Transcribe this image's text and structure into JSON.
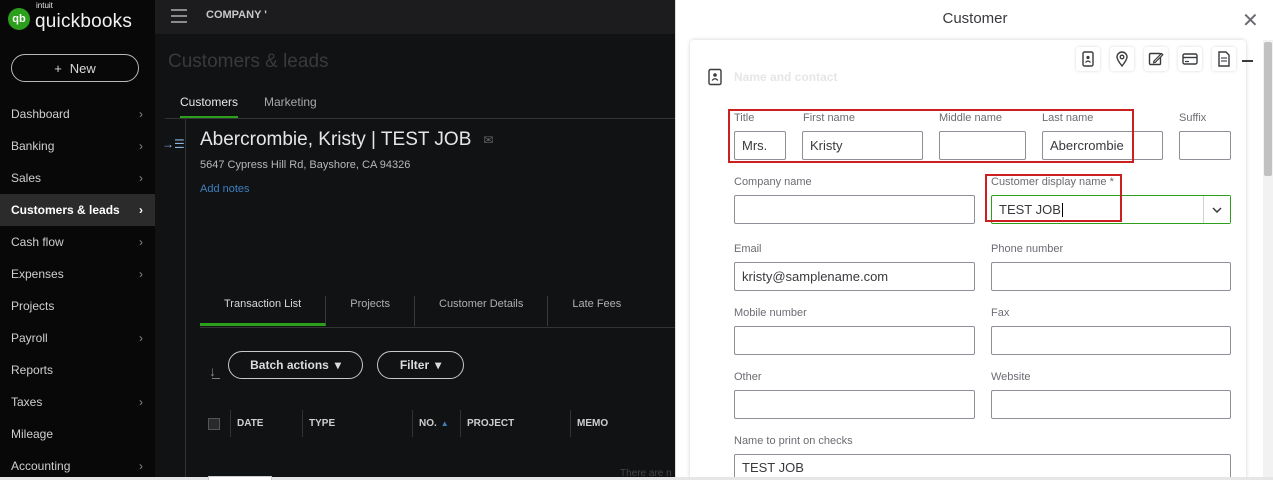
{
  "app": {
    "brand_small": "intuit",
    "brand_name": "quickbooks",
    "brand_badge": "qb",
    "company": "COMPANY '"
  },
  "leftnav": {
    "new_button": "New",
    "new_icon": "plus-icon",
    "items": [
      {
        "label": "Dashboard",
        "chevron": true,
        "active": false
      },
      {
        "label": "Banking",
        "chevron": true,
        "active": false
      },
      {
        "label": "Sales",
        "chevron": true,
        "active": false
      },
      {
        "label": "Customers & leads",
        "chevron": true,
        "active": true
      },
      {
        "label": "Cash flow",
        "chevron": true,
        "active": false
      },
      {
        "label": "Expenses",
        "chevron": true,
        "active": false
      },
      {
        "label": "Projects",
        "chevron": false,
        "active": false
      },
      {
        "label": "Payroll",
        "chevron": true,
        "active": false
      },
      {
        "label": "Reports",
        "chevron": false,
        "active": false
      },
      {
        "label": "Taxes",
        "chevron": true,
        "active": false
      },
      {
        "label": "Mileage",
        "chevron": false,
        "active": false
      },
      {
        "label": "Accounting",
        "chevron": true,
        "active": false
      }
    ]
  },
  "page": {
    "title": "Customers & leads",
    "tabs": [
      "Customers",
      "Marketing"
    ],
    "active_tab": "Customers",
    "customer_name": "Abercrombie, Kristy | TEST JOB",
    "address": "5647 Cypress Hill Rd, Bayshore, CA 94326",
    "add_notes": "Add notes",
    "detail_tabs": [
      "Transaction List",
      "Projects",
      "Customer Details",
      "Late Fees"
    ],
    "batch_actions": "Batch actions",
    "filter": "Filter",
    "table_headers": [
      "DATE",
      "TYPE",
      "NO.",
      "PROJECT",
      "MEMO"
    ],
    "sorted_column": "NO.",
    "footer_text": "There are n"
  },
  "panel": {
    "title": "Customer",
    "section_title": "Name and contact",
    "toolbar_icons": [
      "contact-book-icon",
      "location-pin-icon",
      "edit-note-icon",
      "payment-card-icon",
      "document-icon"
    ],
    "fields": {
      "title": {
        "label": "Title",
        "value": "Mrs."
      },
      "first_name": {
        "label": "First name",
        "value": "Kristy"
      },
      "middle_name": {
        "label": "Middle name",
        "value": ""
      },
      "last_name": {
        "label": "Last name",
        "value": "Abercrombie"
      },
      "suffix": {
        "label": "Suffix",
        "value": ""
      },
      "company_name": {
        "label": "Company name",
        "value": ""
      },
      "display_name": {
        "label": "Customer display name *",
        "value": "TEST JOB"
      },
      "email": {
        "label": "Email",
        "value": "kristy@samplename.com"
      },
      "phone": {
        "label": "Phone number",
        "value": ""
      },
      "mobile": {
        "label": "Mobile number",
        "value": ""
      },
      "fax": {
        "label": "Fax",
        "value": ""
      },
      "other": {
        "label": "Other",
        "value": ""
      },
      "website": {
        "label": "Website",
        "value": ""
      },
      "print_on_checks": {
        "label": "Name to print on checks",
        "value": "TEST JOB"
      }
    },
    "highlight_color": "#cc1f1f",
    "accent_color": "#2ca01c"
  }
}
